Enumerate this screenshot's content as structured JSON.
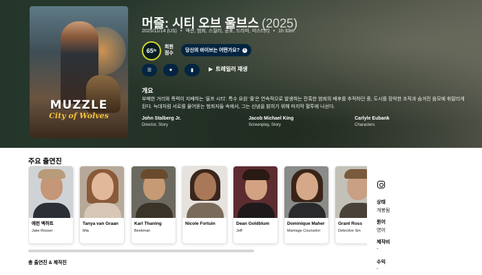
{
  "movie": {
    "title": "머즐: 시티 오브 울브스",
    "year": "(2025)",
    "release": "2025/11/14 (US)",
    "genres": "액션, 범죄, 스릴러, 공포, 드라마, 미스터리",
    "runtime": "1h 33m",
    "score": "65",
    "score_pct": "%",
    "score_label": "회원 점수",
    "vibe": "당신의 바이브는 어떤가요?",
    "trailer": "트레일러 재생",
    "overview_heading": "개요",
    "overview": "부패한 거리와 폭력이 지배하는 '울프 시티'. 특수 요원 '훌'은 연속적으로 발생하는 잔혹한 범죄의 배후를 추적하던 중, 도시를 장악한 조직과 숨겨진 음모에 휘말리게 된다. 늑대처럼 서로를 물어뜯는 범죄자들 속에서, 그는 신념을 밝히기 위해 마지막 혈투에 나선다.",
    "poster_title": "MUZZLE",
    "poster_subtitle": "City of Wolves"
  },
  "crew": [
    {
      "name": "John Stalberg Jr.",
      "job": "Director, Story"
    },
    {
      "name": "Jacob Michael King",
      "job": "Screenplay, Story"
    },
    {
      "name": "Carlyle Eubank",
      "job": "Characters"
    }
  ],
  "cast_heading": "주요 출연진",
  "cast": [
    {
      "name": "에런 엑하트",
      "character": "Jake Rosser"
    },
    {
      "name": "Tanya van Graan",
      "character": "Mia"
    },
    {
      "name": "Karl Thaning",
      "character": "Beekman"
    },
    {
      "name": "Nicole Fortuin",
      "character": ""
    },
    {
      "name": "Dean Goldblum",
      "character": "Jeff"
    },
    {
      "name": "Dominique Maher",
      "character": "Marriage Counselor"
    },
    {
      "name": "Grant Ross",
      "character": "Detective Sm"
    }
  ],
  "full_cast_link": "총 출연진 & 제작진",
  "sidebar": {
    "status_label": "상태",
    "status_value": "개봉됨",
    "lang_label": "원어",
    "lang_value": "영어",
    "budget_label": "제작비",
    "budget_value": "-",
    "revenue_label": "수익",
    "revenue_value": "-"
  },
  "colors": {
    "accent": "#032541",
    "score_ring": "#d2d531"
  }
}
